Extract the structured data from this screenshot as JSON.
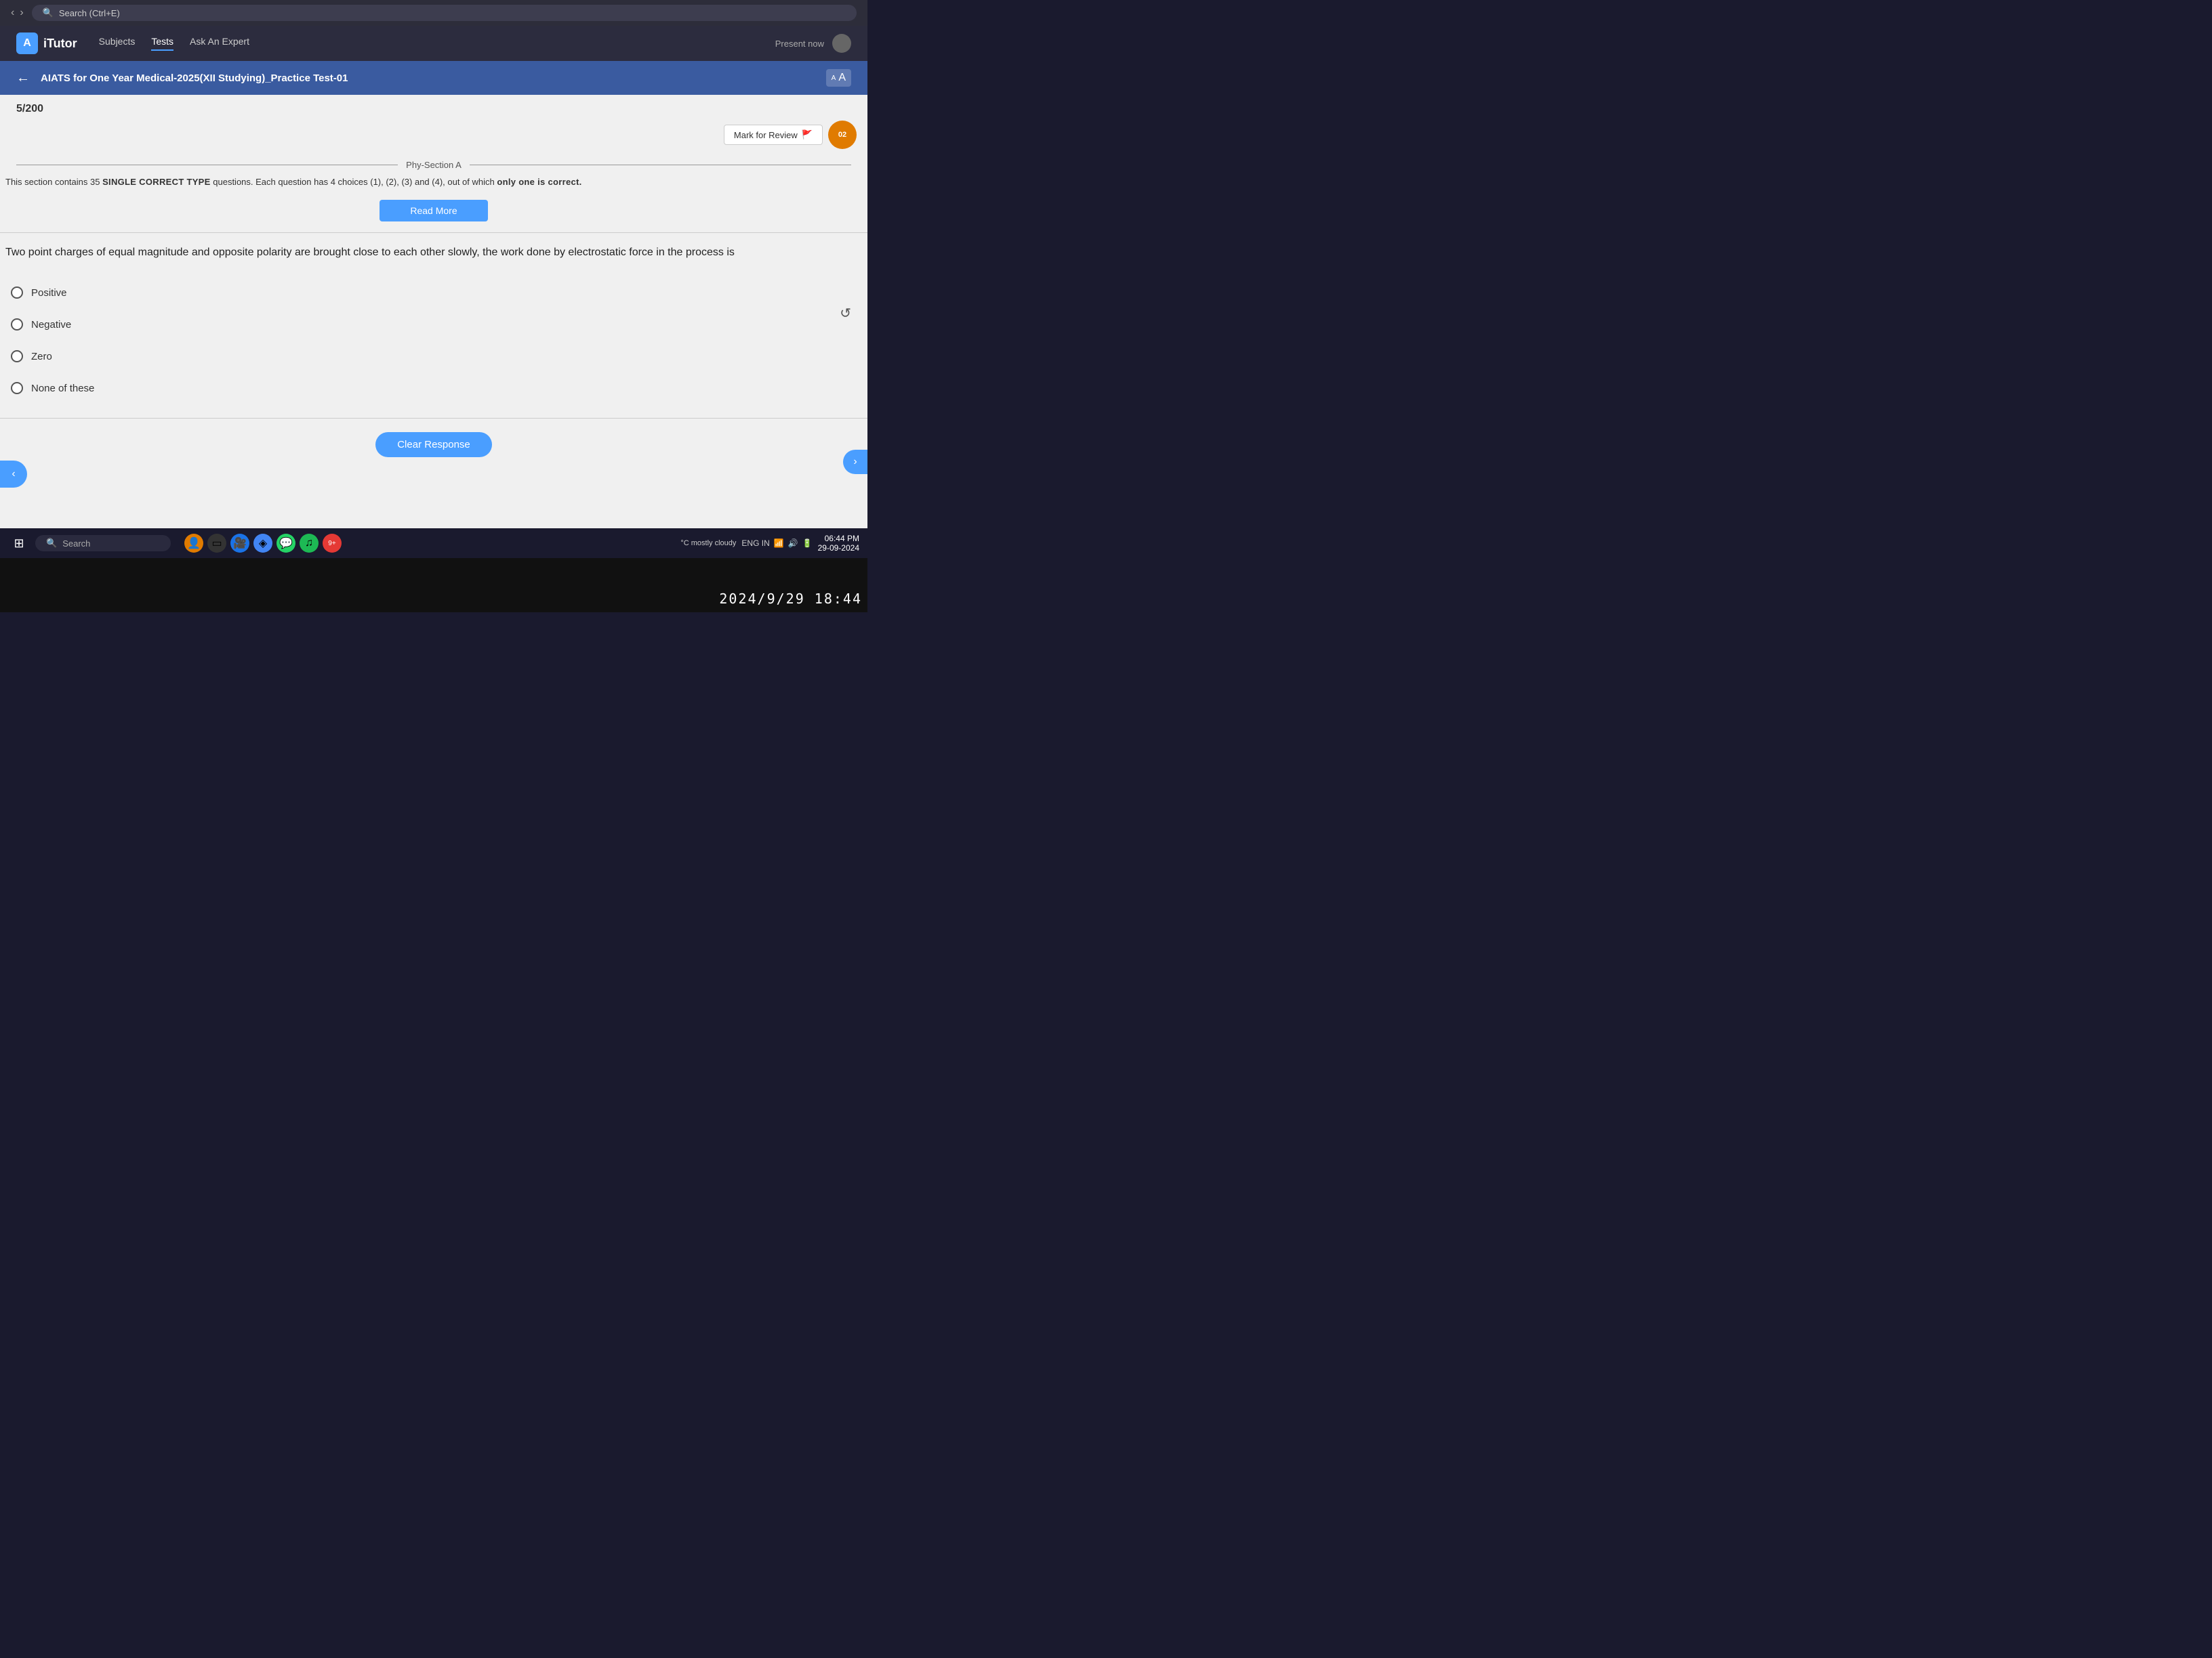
{
  "browser": {
    "search_placeholder": "Search (Ctrl+E)",
    "search_text": "Search (Ctrl+E)"
  },
  "app": {
    "logo": "A",
    "name": "iTutor",
    "nav": {
      "subjects": "Subjects",
      "tests": "Tests",
      "ask_expert": "Ask An Expert"
    },
    "present_now": "Present now"
  },
  "test": {
    "title": "AIATS for One Year Medical-2025(XII Studying)_Practice Test-01",
    "font_label": "A"
  },
  "question": {
    "counter": "5/200",
    "mark_review_label": "Mark for Review",
    "timer_label": "02",
    "section_name": "Phy-Section A",
    "section_info": "This section contains 35 SINGLE CORRECT TYPE questions. Each question has 4 choices (1), (2), (3) and (4), out of which only one is correct.",
    "read_more_label": "Read More",
    "question_text": "Two point charges of equal magnitude and opposite polarity are brought close to each other slowly, the work done by electrostatic force in the process is",
    "options": [
      {
        "id": "A",
        "label": "Positive"
      },
      {
        "id": "B",
        "label": "Negative"
      },
      {
        "id": "C",
        "label": "Zero"
      },
      {
        "id": "D",
        "label": "None of these"
      }
    ],
    "clear_response_label": "Clear Response"
  },
  "taskbar": {
    "search_label": "Search",
    "system": {
      "language": "ENG IN",
      "time": "06:44 PM",
      "date": "29-09-2024"
    },
    "weather": "°C\nmostly cloudy"
  },
  "keyboard": {
    "timestamp": "2024/9/29 18:44"
  },
  "icons": {
    "back": "←",
    "nav_left": "‹",
    "nav_right": "›",
    "search": "🔍",
    "flag": "🚩",
    "chevron_left": "‹",
    "scroll_cursor": "↺"
  }
}
